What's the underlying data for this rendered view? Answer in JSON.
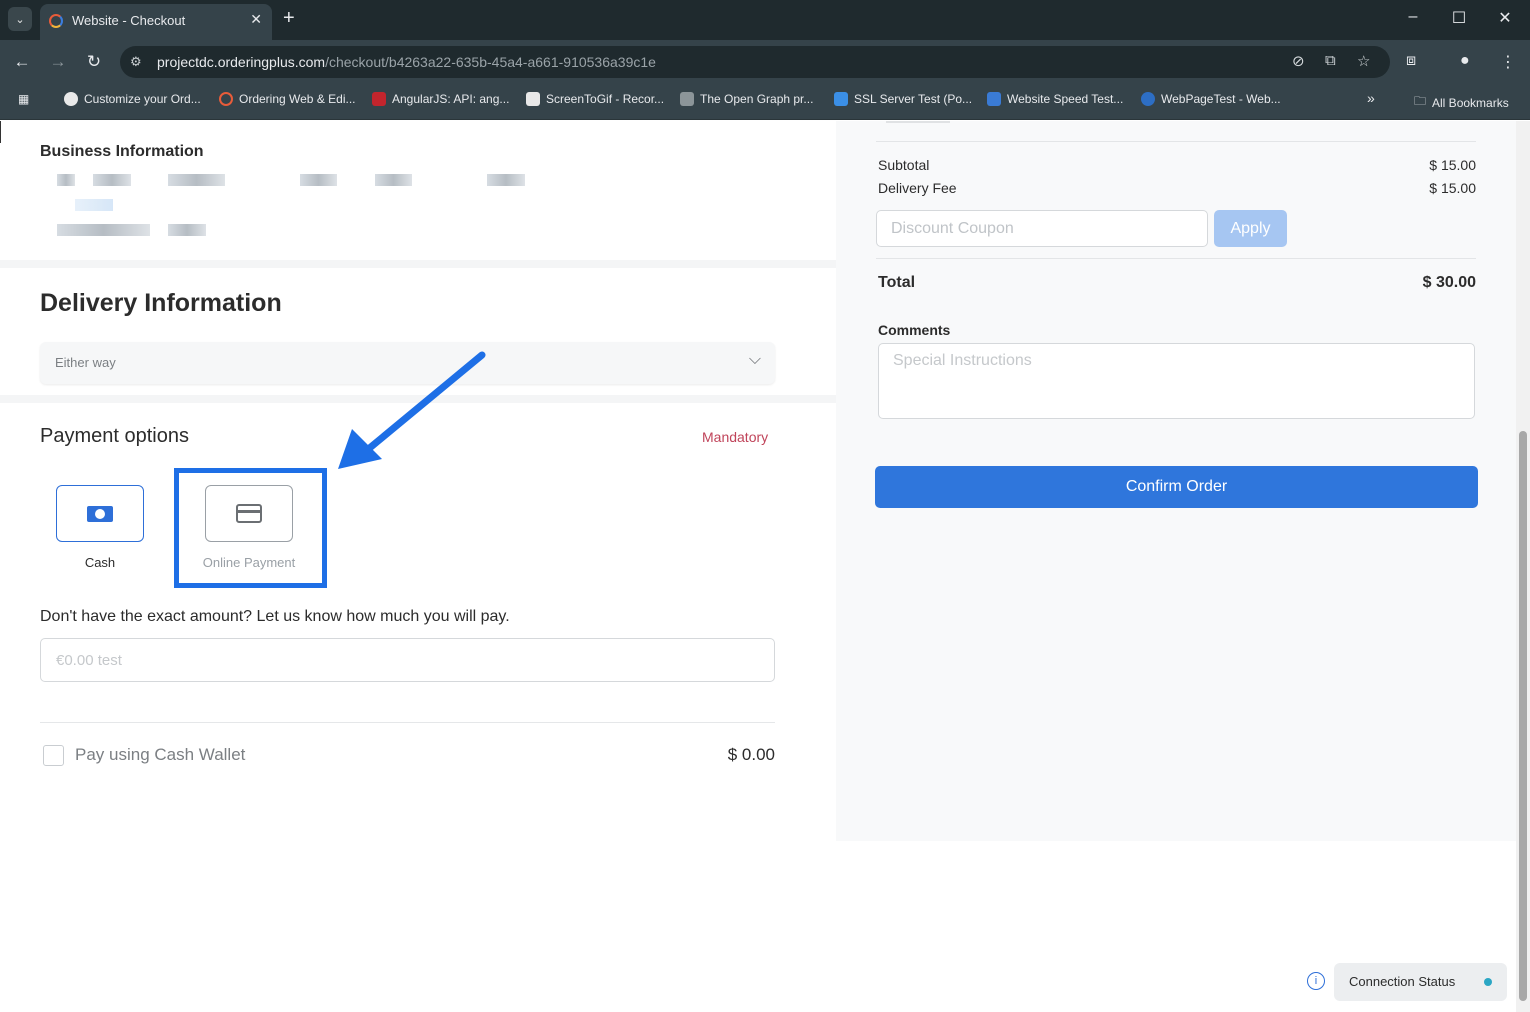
{
  "browser": {
    "tab_title": "Website - Checkout",
    "url_host": "projectdc.orderingplus.com",
    "url_path": "/checkout/b4263a22-635b-45a4-a661-910536a39c1e",
    "bookmarks": [
      "Customize your Ord...",
      "Ordering Web & Edi...",
      "AngularJS: API: ang...",
      "ScreenToGif - Recor...",
      "The Open Graph pr...",
      "SSL Server Test (Po...",
      "Website Speed Test...",
      "WebPageTest - Web..."
    ],
    "all_bookmarks": "All Bookmarks",
    "more_bookmarks": "»"
  },
  "business": {
    "title": "Business Information"
  },
  "delivery": {
    "title": "Delivery Information",
    "select_value": "Either way"
  },
  "payment": {
    "title": "Payment options",
    "mandatory": "Mandatory",
    "options": [
      {
        "label": "Cash",
        "selected": true
      },
      {
        "label": "Online Payment",
        "selected": false
      }
    ],
    "exact_text": "Don't have the exact amount? Let us know how much you will pay.",
    "amount_placeholder": "€0.00 test",
    "wallet_label": "Pay using Cash Wallet",
    "wallet_amount": "$ 0.00"
  },
  "summary": {
    "subtotal_label": "Subtotal",
    "subtotal_value": "$ 15.00",
    "delivery_fee_label": "Delivery Fee",
    "delivery_fee_value": "$ 15.00",
    "coupon_placeholder": "Discount Coupon",
    "apply_label": "Apply",
    "total_label": "Total",
    "total_value": "$ 30.00",
    "comments_label": "Comments",
    "comments_placeholder": "Special Instructions",
    "confirm_label": "Confirm Order"
  },
  "connection": {
    "label": "Connection Status",
    "info_glyph": "i"
  },
  "colors": {
    "accent": "#2f76dc",
    "highlight": "#1e6fe6",
    "mandatory": "#c0445a",
    "status_dot": "#2ba6c4"
  }
}
